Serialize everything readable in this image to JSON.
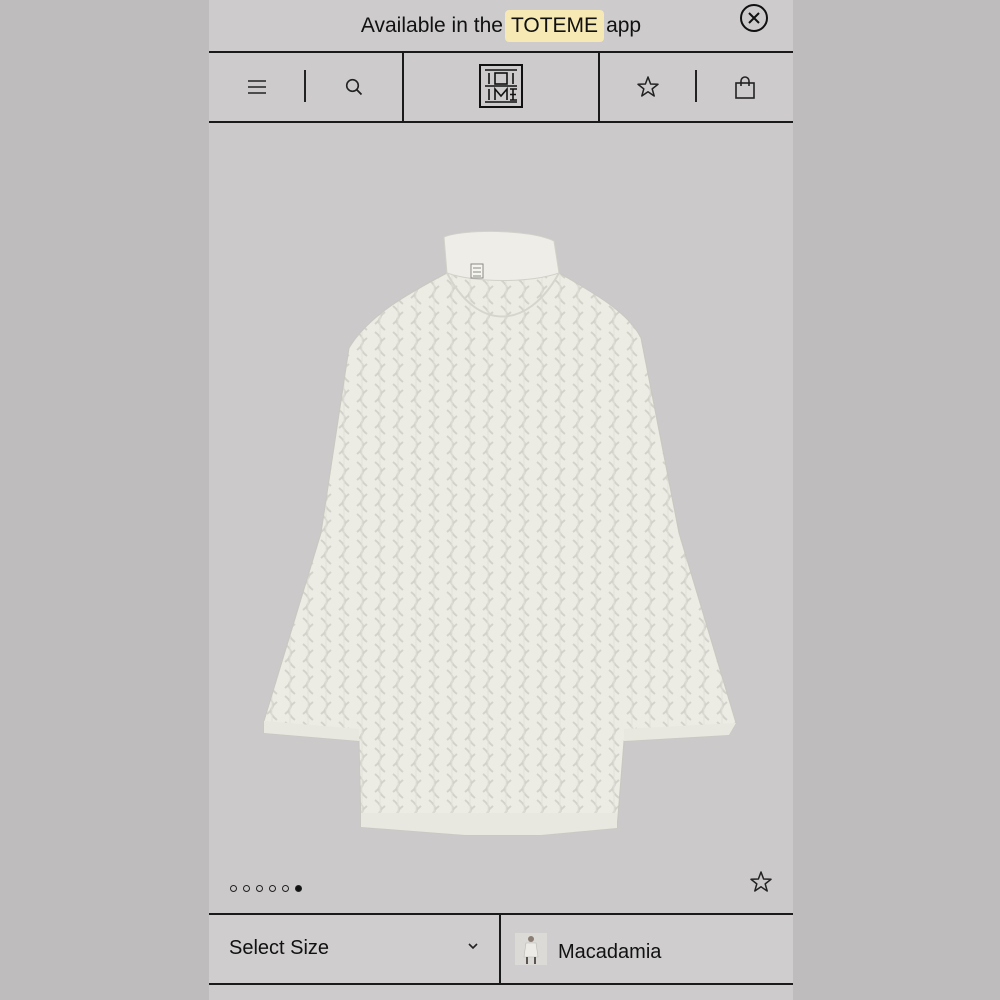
{
  "banner": {
    "text_before": "Available in the",
    "brand": "TOTEME",
    "text_after": "app"
  },
  "product": {
    "color_name": "Macadamia",
    "image_count": 6,
    "active_image_index": 6
  },
  "size_select": {
    "label": "Select Size"
  }
}
